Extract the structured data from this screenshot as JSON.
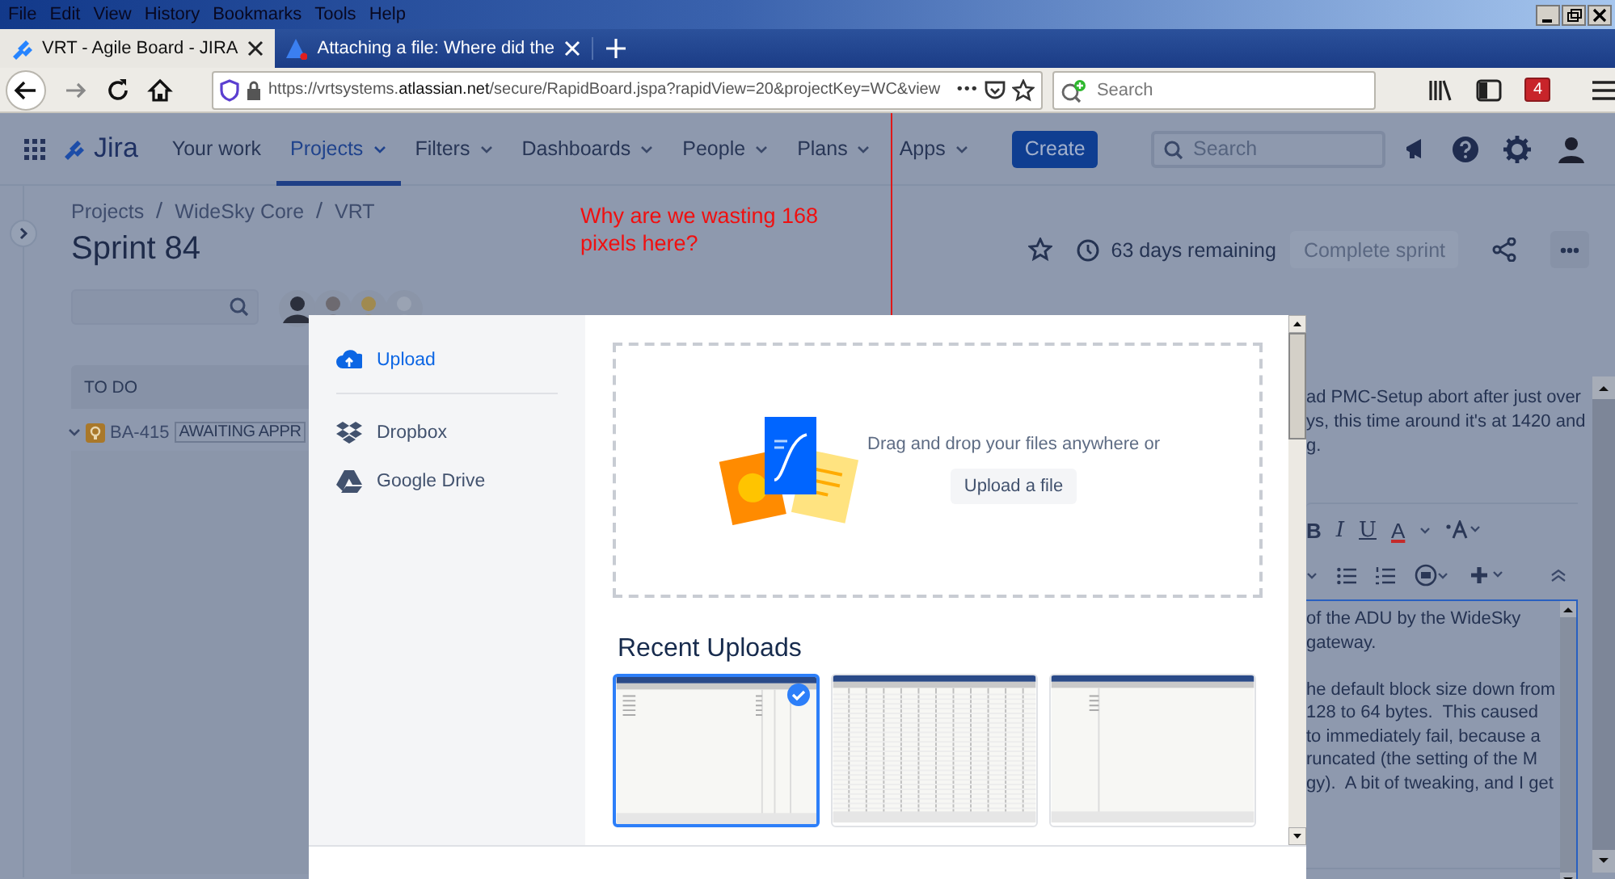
{
  "browser": {
    "menu": [
      "File",
      "Edit",
      "View",
      "History",
      "Bookmarks",
      "Tools",
      "Help"
    ],
    "tabs": [
      {
        "title": "VRT - Agile Board - JIRA",
        "selected": true
      },
      {
        "title": "Attaching a file: Where did the",
        "selected": false
      }
    ],
    "address": {
      "scheme": "https://vrtsystems.",
      "domain": "atlassian.net",
      "path": "/secure/RapidBoard.jspa?rapidView=20&projectKey=WC&view"
    },
    "more": "•••",
    "search": {
      "placeholder": "Search"
    },
    "badge": "4"
  },
  "jira_nav": {
    "logo": "Jira",
    "items": [
      {
        "label": "Your work",
        "dropdown": false,
        "selected": false
      },
      {
        "label": "Projects",
        "dropdown": true,
        "selected": true
      },
      {
        "label": "Filters",
        "dropdown": true,
        "selected": false
      },
      {
        "label": "Dashboards",
        "dropdown": true,
        "selected": false
      },
      {
        "label": "People",
        "dropdown": true,
        "selected": false
      },
      {
        "label": "Plans",
        "dropdown": true,
        "selected": false
      },
      {
        "label": "Apps",
        "dropdown": true,
        "selected": false
      }
    ],
    "create": "Create",
    "search": {
      "placeholder": "Search"
    }
  },
  "board": {
    "breadcrumbs": [
      "Projects",
      "WideSky Core",
      "VRT"
    ],
    "title": "Sprint 84",
    "remaining": "63 days remaining",
    "complete_button": "Complete sprint",
    "column": "TO DO",
    "issue": {
      "key": "BA-415",
      "status": "AWAITING APPR"
    },
    "comment_lines": [
      "ad PMC-Setup abort after just over",
      "ys, this time around it's at 1420 and",
      "g."
    ],
    "editor": {
      "format_buttons": [
        {
          "label": "B",
          "kind": "bold"
        },
        {
          "label": "I",
          "kind": "italic"
        },
        {
          "label": "U",
          "kind": "underline"
        },
        {
          "label": "A",
          "kind": "color"
        }
      ],
      "lines": [
        {
          "text": "of the ADU by the WideSky"
        },
        {
          "text": "gateway."
        },
        {
          "text": "he default block size down from",
          "gap_before": true
        },
        {
          "text": "128 to 64 bytes.  This caused"
        },
        {
          "text": "to immediately fail, because a"
        },
        {
          "text": "runcated (the setting of the M"
        },
        {
          "text": "gy).  A bit of tweaking, and I get"
        }
      ]
    }
  },
  "annotation": "Why are we wasting 168 pixels here?",
  "upload": {
    "sources": [
      {
        "label": "Upload",
        "kind": "upload",
        "selected": true
      },
      {
        "label": "Dropbox",
        "kind": "dropbox",
        "selected": false
      },
      {
        "label": "Google Drive",
        "kind": "drive",
        "selected": false
      }
    ],
    "drop_text": "Drag and drop your files anywhere or",
    "upload_button": "Upload a file",
    "recent_title": "Recent Uploads",
    "thumbnails": [
      {
        "kind": "narrow",
        "selected": true
      },
      {
        "kind": "grid",
        "selected": false
      },
      {
        "kind": "sparse",
        "selected": false
      }
    ]
  }
}
